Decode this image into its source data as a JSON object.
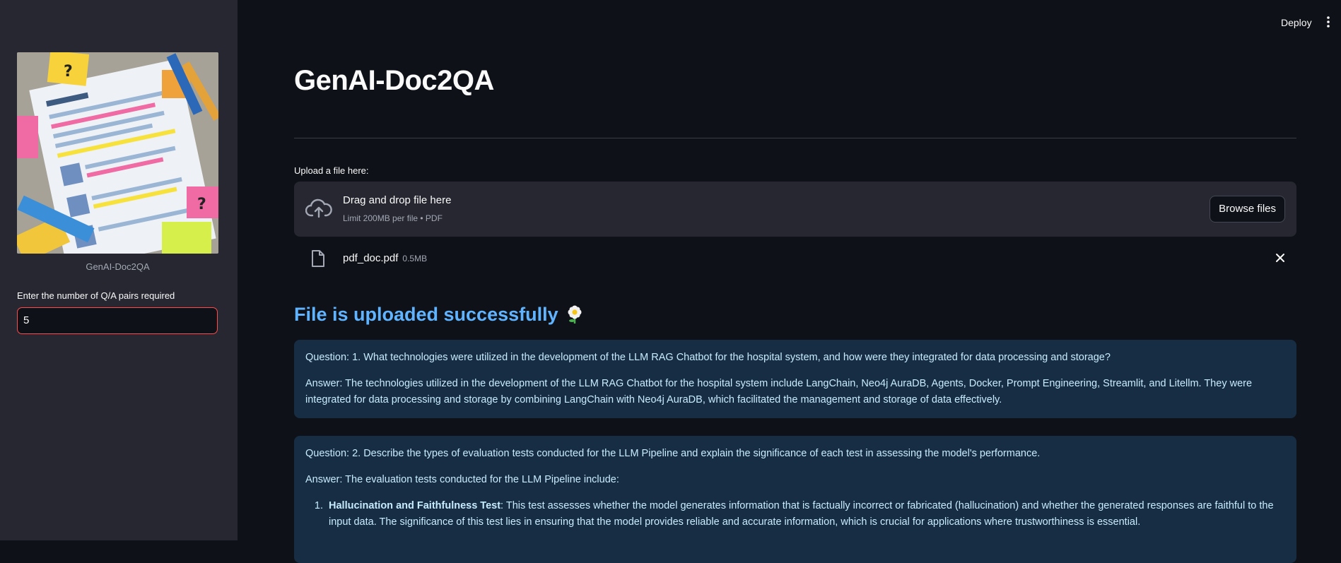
{
  "header": {
    "deploy_label": "Deploy",
    "menu_icon": "vertical-dots-icon"
  },
  "sidebar": {
    "image_caption": "GenAI-Doc2QA",
    "num_pairs_label": "Enter the number of Q/A pairs required",
    "num_pairs_value": "5"
  },
  "main": {
    "title": "GenAI-Doc2QA",
    "upload_label": "Upload a file here:",
    "dropzone": {
      "title": "Drag and drop file here",
      "subtitle": "Limit 200MB per file • PDF",
      "browse_label": "Browse files"
    },
    "file": {
      "name": "pdf_doc.pdf",
      "size": "0.5MB"
    },
    "success_message": "File is uploaded successfully",
    "qa": [
      {
        "question": "Question: 1. What technologies were utilized in the development of the LLM RAG Chatbot for the hospital system, and how were they integrated for data processing and storage?",
        "answer": "Answer: The technologies utilized in the development of the LLM RAG Chatbot for the hospital system include LangChain, Neo4j AuraDB, Agents, Docker, Prompt Engineering, Streamlit, and Litellm. They were integrated for data processing and storage by combining LangChain with Neo4j AuraDB, which facilitated the management and storage of data effectively."
      },
      {
        "question": "Question: 2. Describe the types of evaluation tests conducted for the LLM Pipeline and explain the significance of each test in assessing the model's performance.",
        "answer": "Answer: The evaluation tests conducted for the LLM Pipeline include:",
        "list": [
          {
            "term": "Hallucination and Faithfulness Test",
            "text": ": This test assesses whether the model generates information that is factually incorrect or fabricated (hallucination) and whether the generated responses are faithful to the input data. The significance of this test lies in ensuring that the model provides reliable and accurate information, which is crucial for applications where trustworthiness is essential."
          }
        ]
      }
    ]
  },
  "colors": {
    "background": "#0e1117",
    "sidebar": "#262730",
    "accent_error": "#ff4b4b",
    "heading_blue": "#60b4ff",
    "info_bg": "#172d43",
    "info_text": "#c7ebff"
  }
}
